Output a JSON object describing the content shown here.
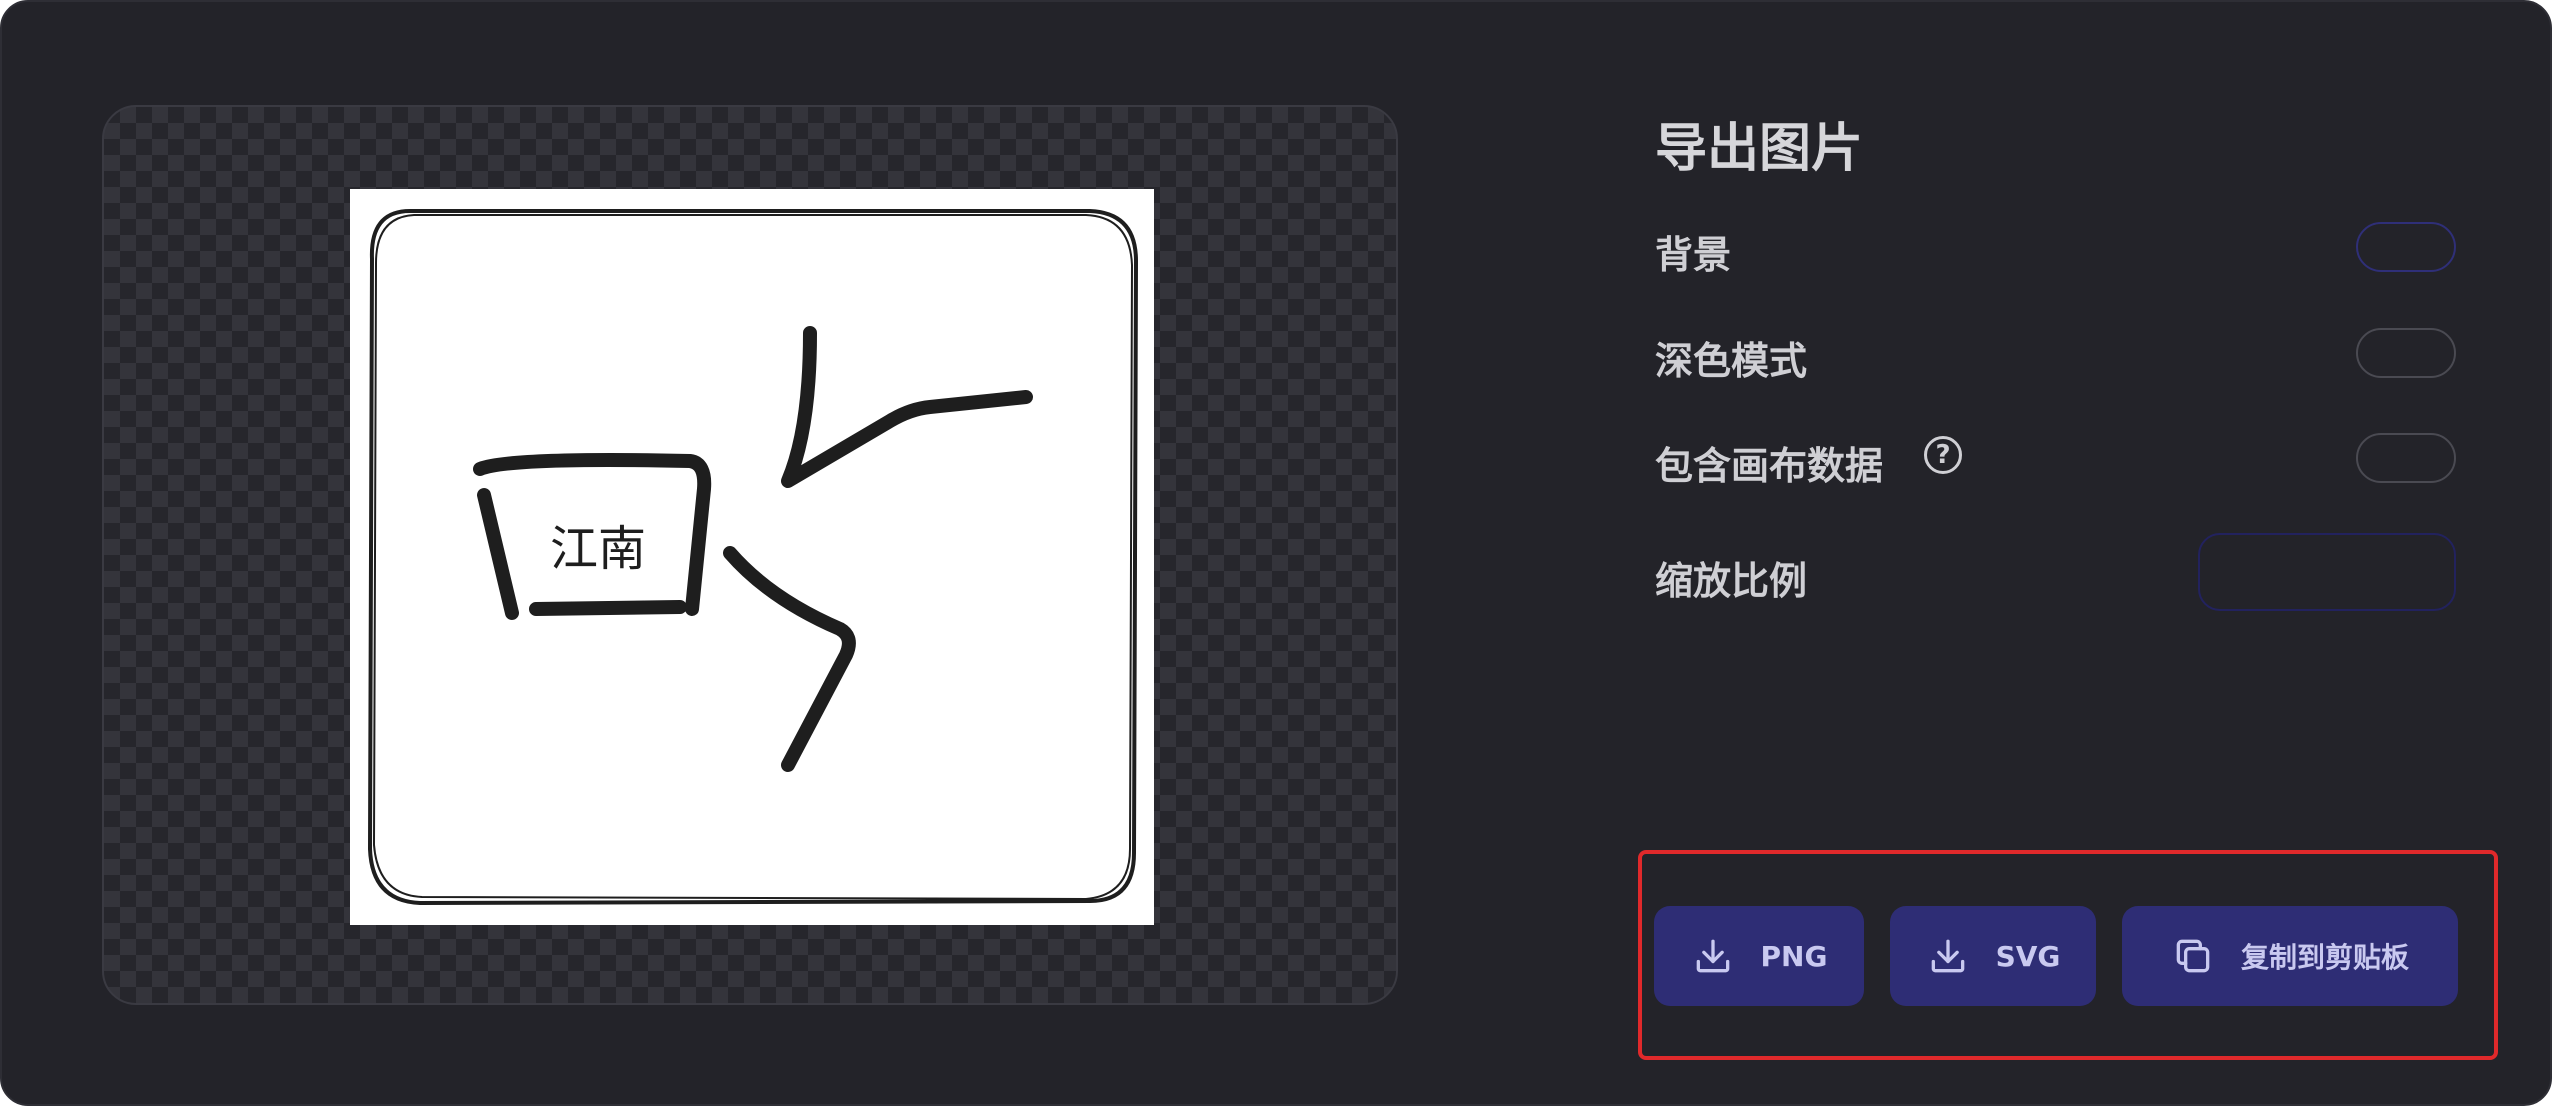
{
  "dialog": {
    "title": "导出图片"
  },
  "preview": {
    "canvas_text": "江南"
  },
  "settings": {
    "background_label": "背景",
    "dark_mode_label": "深色模式",
    "embed_scene_label": "包含画布数据",
    "embed_help_icon": "question-circle-icon",
    "help_glyph": "?",
    "scale_label": "缩放比例"
  },
  "actions": {
    "png_label": "PNG",
    "svg_label": "SVG",
    "copy_label": "复制到剪贴板",
    "download_icon": "download-icon",
    "copy_icon": "copy-icon"
  },
  "colors": {
    "dialog_bg": "#232329",
    "button_bg": "#2e2d75",
    "highlight_border": "#e0292b",
    "text": "#cfcfd4"
  }
}
